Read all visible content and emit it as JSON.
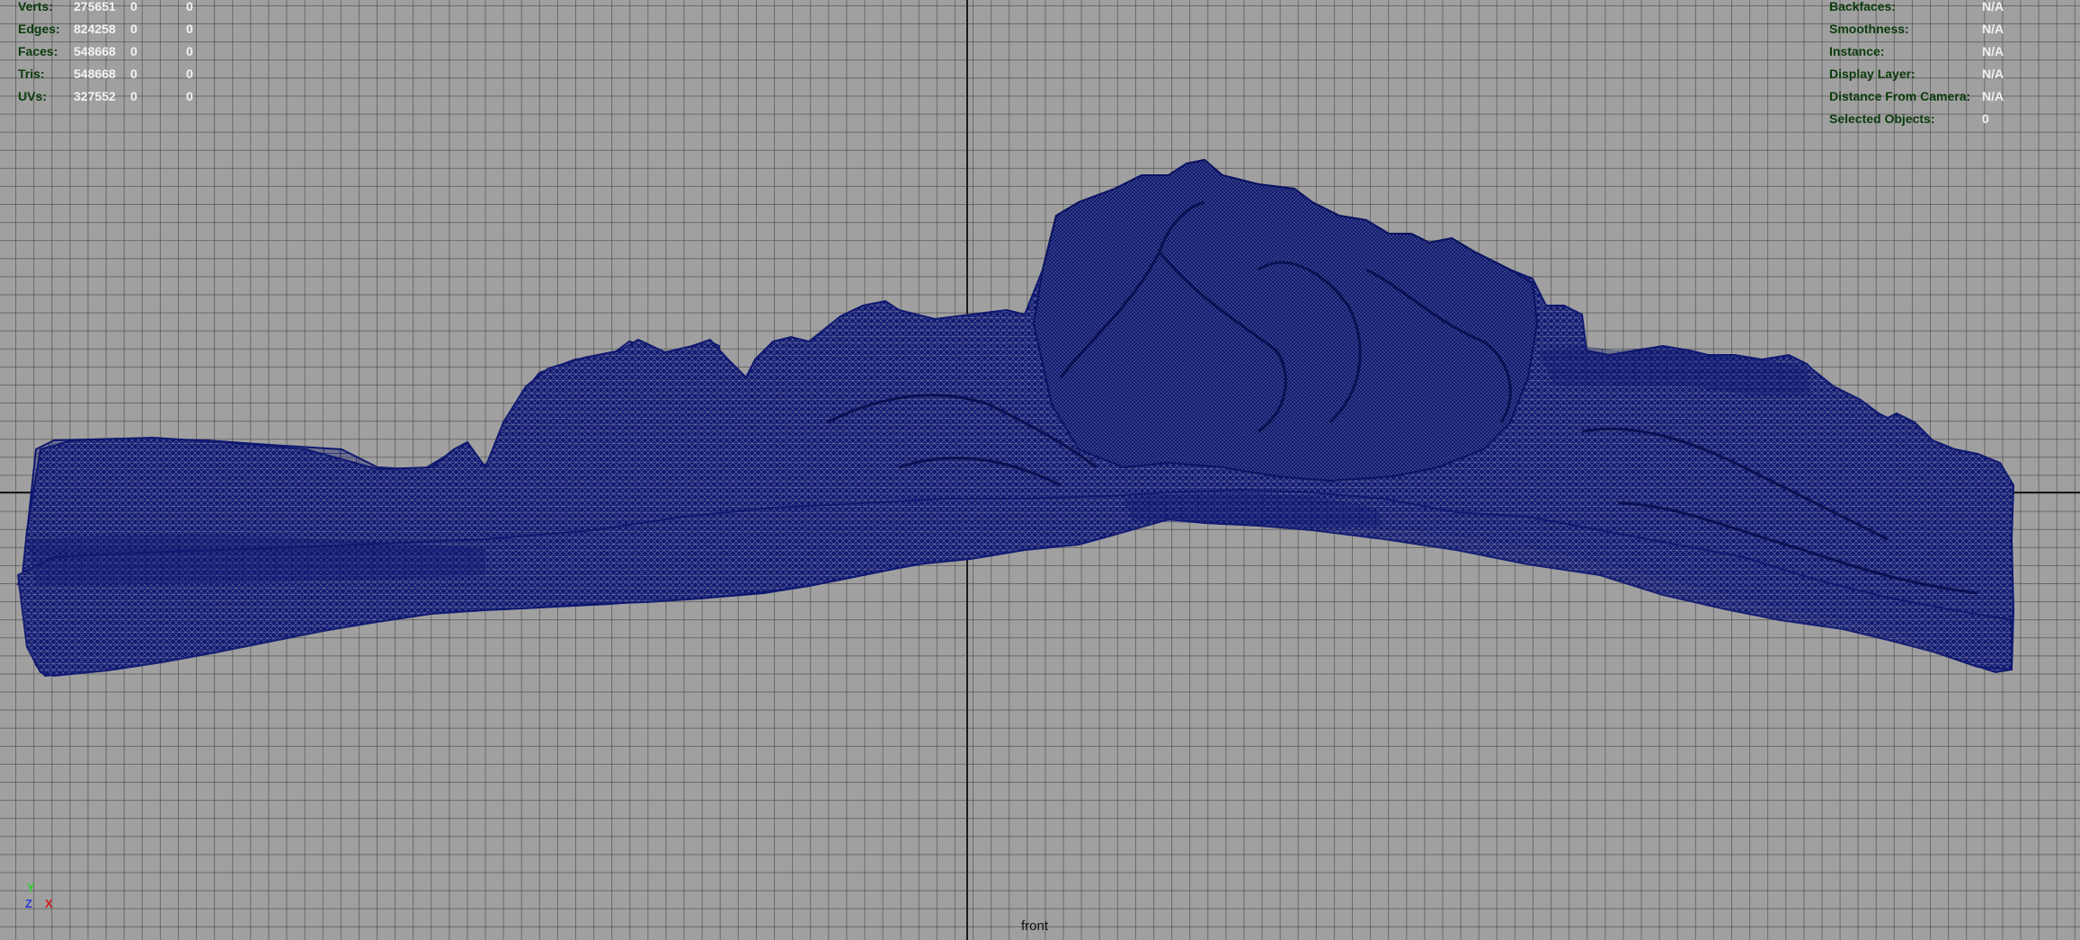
{
  "viewport": {
    "camera": "front",
    "background_color": "#a0a0a0",
    "mesh_color": "#0f1870",
    "wire_color": "#b8bccd"
  },
  "poly_stats": {
    "rows": [
      {
        "label": "Verts:",
        "total": "275651",
        "selected": "0",
        "extra": "0"
      },
      {
        "label": "Edges:",
        "total": "824258",
        "selected": "0",
        "extra": "0"
      },
      {
        "label": "Faces:",
        "total": "548668",
        "selected": "0",
        "extra": "0"
      },
      {
        "label": "Tris:",
        "total": "548668",
        "selected": "0",
        "extra": "0"
      },
      {
        "label": "UVs:",
        "total": "327552",
        "selected": "0",
        "extra": "0"
      }
    ]
  },
  "object_info": {
    "rows": [
      {
        "label": "Backfaces:",
        "value": "N/A"
      },
      {
        "label": "Smoothness:",
        "value": "N/A"
      },
      {
        "label": "Instance:",
        "value": "N/A"
      },
      {
        "label": "Display Layer:",
        "value": "N/A"
      },
      {
        "label": "Distance From Camera:",
        "value": "N/A"
      },
      {
        "label": "Selected Objects:",
        "value": "0"
      }
    ]
  },
  "axis_gizmo": {
    "y": "Y",
    "z": "Z",
    "x": "X"
  }
}
